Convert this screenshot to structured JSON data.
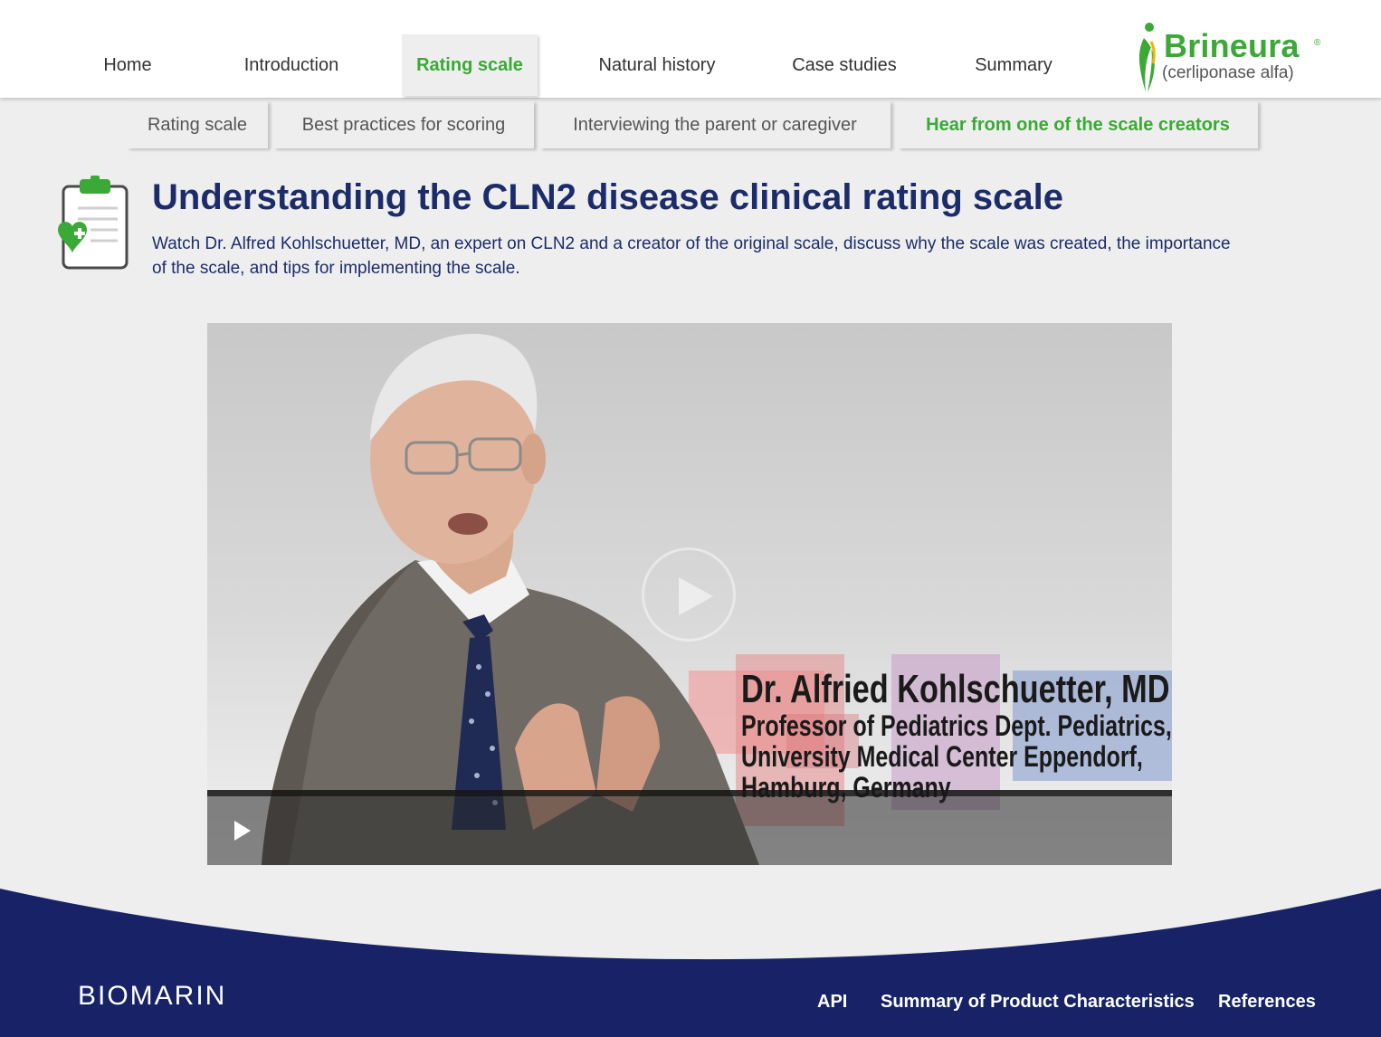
{
  "nav": {
    "items": [
      {
        "label": "Home"
      },
      {
        "label": "Introduction"
      },
      {
        "label": "Rating scale"
      },
      {
        "label": "Natural history"
      },
      {
        "label": "Case studies"
      },
      {
        "label": "Summary"
      }
    ],
    "active": "Rating scale"
  },
  "brand": {
    "name": "Brineura",
    "registered": "®",
    "subtitle": "(cerliponase alfa)",
    "color": "#3aa935"
  },
  "subnav": {
    "items": [
      {
        "label": "Rating scale"
      },
      {
        "label": "Best practices for scoring"
      },
      {
        "label": "Interviewing the parent or caregiver"
      },
      {
        "label": "Hear from one of the scale creators"
      }
    ],
    "active": "Hear from one of the scale creators"
  },
  "main": {
    "icon": "clipboard-heart-icon",
    "title": "Understanding the CLN2 disease clinical rating scale",
    "description": "Watch Dr. Alfred Kohlschuetter, MD, an expert on CLN2 and a creator of the original scale, discuss why the scale was created, the importance of the scale, and tips for implementing the scale."
  },
  "video": {
    "caption_name": "Dr. Alfried Kohlschuetter, MD",
    "caption_lines": [
      "Professor of Pediatrics Dept. Pediatrics,",
      "University Medical Center Eppendorf,",
      "Hamburg, Germany"
    ],
    "play_icon": "play-icon"
  },
  "footer": {
    "company": "BIOMARIN",
    "links": [
      {
        "label": "API"
      },
      {
        "label": "Summary of Product Characteristics"
      },
      {
        "label": "References"
      }
    ],
    "color": "#172366"
  },
  "colors": {
    "title": "#1c2c6b",
    "accent_green": "#3aa935",
    "footer_navy": "#172366"
  }
}
